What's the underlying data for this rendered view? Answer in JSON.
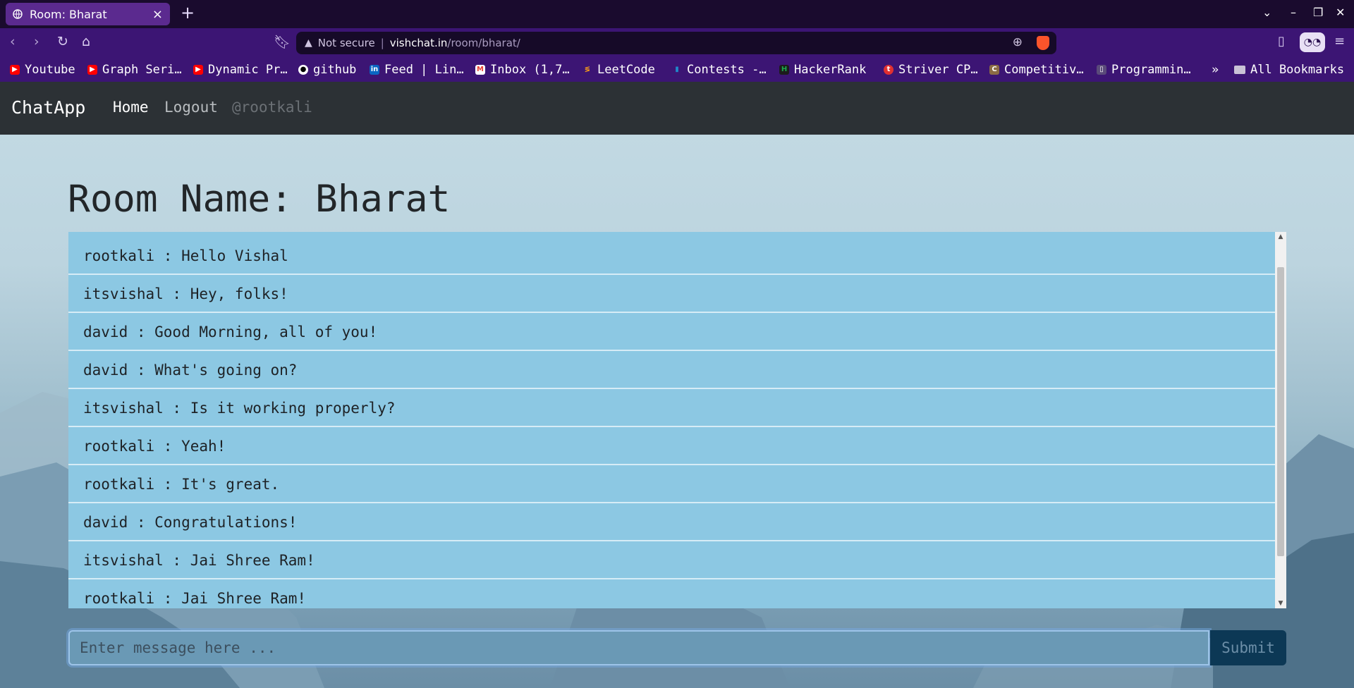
{
  "browser": {
    "tab_title": "Room: Bharat",
    "tab_close": "×",
    "new_tab": "+",
    "security_label": "Not secure",
    "url_host": "vishchat.in",
    "url_path": "/room/bharat/",
    "bookmarks": [
      {
        "label": "Youtube",
        "icon": "youtube-icon",
        "color": "#ff0000"
      },
      {
        "label": "Graph Seri…",
        "icon": "youtube-icon",
        "color": "#ff0000"
      },
      {
        "label": "Dynamic Pr…",
        "icon": "youtube-icon",
        "color": "#ff0000"
      },
      {
        "label": "github",
        "icon": "github-icon",
        "color": "#ffffff"
      },
      {
        "label": "Feed | Lin…",
        "icon": "linkedin-icon",
        "color": "#0a66c2"
      },
      {
        "label": "Inbox (1,7…",
        "icon": "gmail-icon",
        "color": "#ea4335"
      },
      {
        "label": "LeetCode",
        "icon": "leetcode-icon",
        "color": "#ffa116"
      },
      {
        "label": "Contests -…",
        "icon": "codeforces-icon",
        "color": "#1f8acb"
      },
      {
        "label": "HackerRank",
        "icon": "hackerrank-icon",
        "color": "#1ba94c"
      },
      {
        "label": "Striver CP…",
        "icon": "tuf-icon",
        "color": "#e03030"
      },
      {
        "label": "Competitiv…",
        "icon": "codechef-icon",
        "color": "#8b6b45"
      },
      {
        "label": "Programmin…",
        "icon": "page-icon",
        "color": "#5a4a7a"
      }
    ],
    "bookmarks_overflow": "»",
    "all_bookmarks": "All Bookmarks"
  },
  "navbar": {
    "brand": "ChatApp",
    "home": "Home",
    "logout": "Logout",
    "user": "@rootkali"
  },
  "room": {
    "title": "Room Name: Bharat"
  },
  "messages": [
    {
      "text": "rootkali : Hello Vishal"
    },
    {
      "text": "itsvishal : Hey, folks!"
    },
    {
      "text": "david : Good Morning, all of you!"
    },
    {
      "text": "david : What's going on?"
    },
    {
      "text": "itsvishal : Is it working properly?"
    },
    {
      "text": "rootkali : Yeah!"
    },
    {
      "text": "rootkali : It's great."
    },
    {
      "text": "david : Congratulations!"
    },
    {
      "text": "itsvishal : Jai Shree Ram!"
    },
    {
      "text": "rootkali : Jai Shree Ram!"
    }
  ],
  "composer": {
    "placeholder": "Enter message here ...",
    "submit": "Submit"
  },
  "colors": {
    "navbar_bg": "#2c3135",
    "message_bg": "#8cc8e3",
    "submit_bg": "#0c3855",
    "browser_accent": "#3c1574"
  }
}
